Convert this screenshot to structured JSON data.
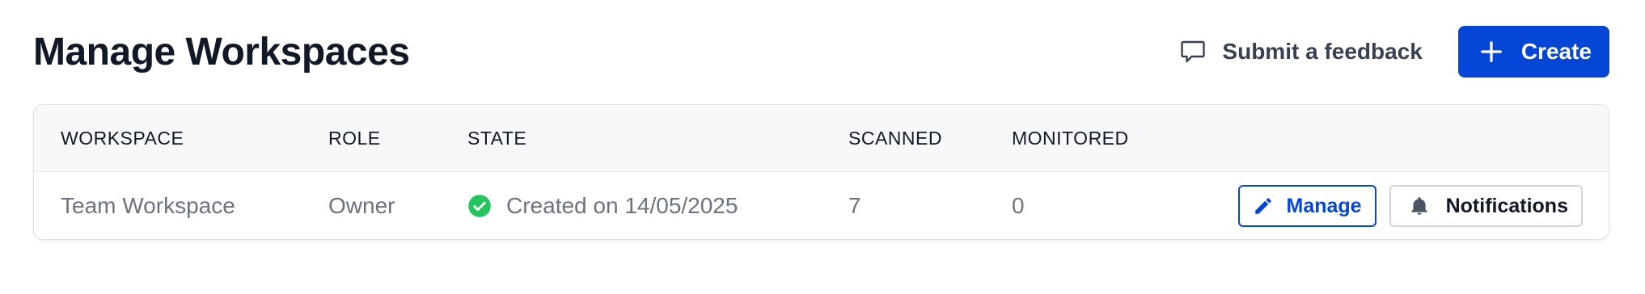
{
  "header": {
    "title": "Manage Workspaces",
    "feedback_label": "Submit a feedback",
    "create_label": "Create"
  },
  "table": {
    "columns": [
      "WORKSPACE",
      "ROLE",
      "STATE",
      "SCANNED",
      "MONITORED"
    ],
    "rows": [
      {
        "workspace": "Team Workspace",
        "role": "Owner",
        "state": "Created on 14/05/2025",
        "state_icon": "check-circle-icon",
        "scanned": "7",
        "monitored": "0",
        "manage_label": "Manage",
        "notifications_label": "Notifications"
      }
    ]
  },
  "colors": {
    "primary": "#0646d6",
    "success": "#22c55e",
    "header_bg": "#f7f8fa"
  }
}
